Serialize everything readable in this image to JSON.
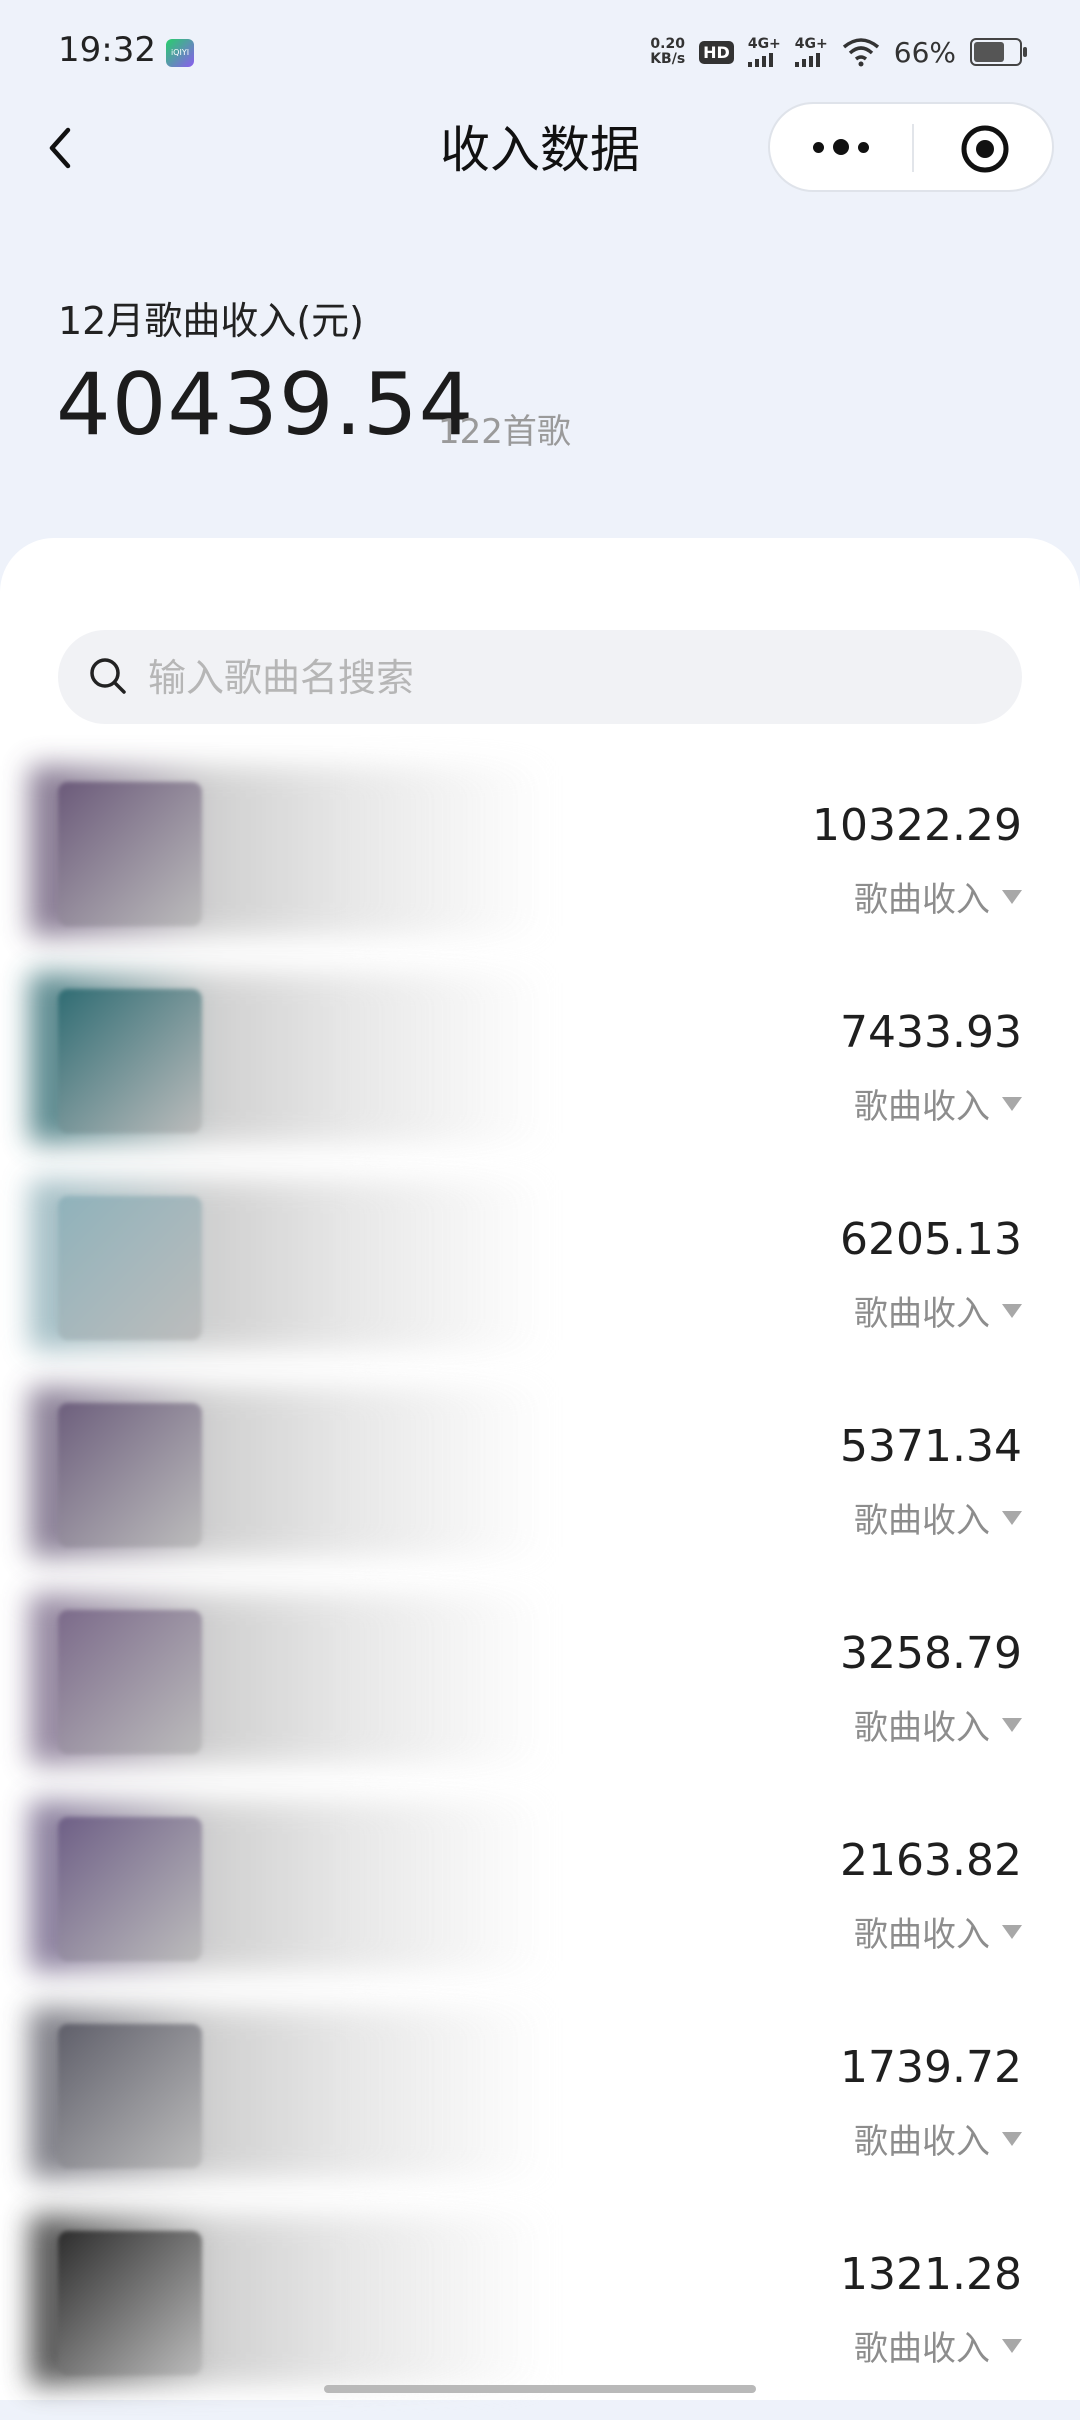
{
  "status_bar": {
    "time": "19:32",
    "app_badge": "iQIYI",
    "net_speed_value": "0.20",
    "net_speed_unit": "KB/s",
    "hd": "HD",
    "signal_1": "4G+",
    "signal_2": "4G+",
    "battery": "66%"
  },
  "nav": {
    "title": "收入数据"
  },
  "summary": {
    "label": "12月歌曲收入(元)",
    "total": "40439.54",
    "song_count": "122首歌"
  },
  "search": {
    "placeholder": "输入歌曲名搜索"
  },
  "songs": [
    {
      "amount": "10322.29",
      "label": "歌曲收入",
      "tint": "#6b5a7a"
    },
    {
      "amount": "7433.93",
      "label": "歌曲收入",
      "tint": "#2f6c73"
    },
    {
      "amount": "6205.13",
      "label": "歌曲收入",
      "tint": "#8fb2bb"
    },
    {
      "amount": "5371.34",
      "label": "歌曲收入",
      "tint": "#6d5f7d"
    },
    {
      "amount": "3258.79",
      "label": "歌曲收入",
      "tint": "#7b6a8a"
    },
    {
      "amount": "2163.82",
      "label": "歌曲收入",
      "tint": "#6e5f86"
    },
    {
      "amount": "1739.72",
      "label": "歌曲收入",
      "tint": "#5f5f6a"
    },
    {
      "amount": "1321.28",
      "label": "歌曲收入",
      "tint": "#2d2d2d"
    }
  ]
}
